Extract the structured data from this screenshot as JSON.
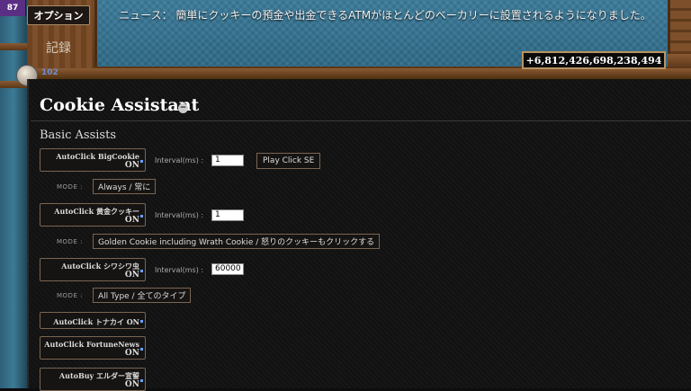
{
  "header": {
    "level": "87",
    "options_label": "オプション",
    "stats_label": "記録",
    "news": "ニュース： 簡単にクッキーの預金や出金できるATMがほとんどのベーカリーに設置されるようになりました。",
    "cookie_count": "+6,812,426,698,238,494",
    "counter": "102"
  },
  "assistant": {
    "title": "Cookie Assistant",
    "collapse_symbol": "−",
    "section": "Basic Assists",
    "interval_label": "Interval(ms) :",
    "mode_label": "MODE :",
    "play_label": "Play Click SE",
    "state_on": "ON",
    "options": [
      {
        "label": "AutoClick BigCookie",
        "interval": "1",
        "mode": "Always / 常に"
      },
      {
        "label": "AutoClick 黄金クッキー",
        "interval": "1",
        "mode": "Golden Cookie including Wrath Cookie / 怒りのクッキーもクリックする"
      },
      {
        "label": "AutoClick シワシワ虫",
        "interval": "60000",
        "mode": "All Type / 全てのタイプ"
      },
      {
        "label": "AutoClick トナカイ ON"
      },
      {
        "label": "AutoClick FortuneNews"
      },
      {
        "label": "AutoBuy エルダー宣誓"
      }
    ]
  }
}
